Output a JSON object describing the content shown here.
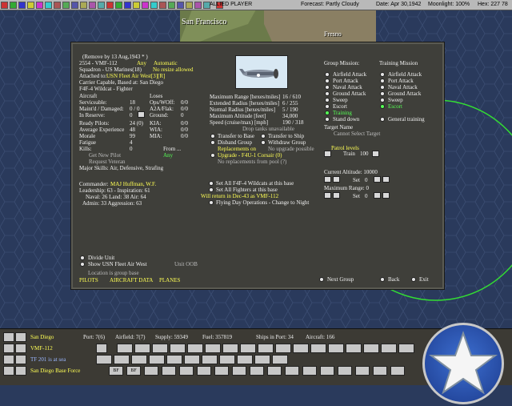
{
  "topbar": {
    "player": "ALLIED PLAYER",
    "forecast": "Forecast: Partly Cloudy",
    "date": "Date: Apr 30,1942",
    "moonlight": "Moonlight: 100%",
    "hex": "Hex: 227 78"
  },
  "map": {
    "city_label": "San Francisco",
    "city2_label": "Fresno"
  },
  "unit": {
    "removed_line": "(Remove by 13 Aug,1943 * )",
    "name": "2554 - VMF-112",
    "any": "Any",
    "automatic": "Automatic",
    "squadron": "Squadron - US Marines(18)",
    "no_resize": "No resize allowed",
    "attached_to_label": "Attached to:",
    "attached_to_value": "USN Fleet Air West[3][R]",
    "carrier_capable": "Carrier Capable, Based at: San Diego",
    "aircraft_type": "F4F-4 Wildcat - Fighter",
    "aircraft_label": "Aircraft",
    "losses_label": "Loses",
    "serviceable_label": "Serviceable:",
    "serviceable_value": "18",
    "ops_woff_label": "Ops/WOff:",
    "ops_woff_value": "0/0",
    "maint_label": "Maint'd / Damaged:",
    "maint_value": "0 / 0",
    "a2a_label": "A2A/Flak:",
    "a2a_value": "0/0",
    "reserve_label": "In Reserve:",
    "reserve_value": "0",
    "ground_label": "Ground:",
    "ground_value": "0",
    "ready_pilots_label": "Ready Pilots:",
    "ready_pilots_value": "24 (0)",
    "kia_label": "KIA:",
    "kia_value": "0/0",
    "avg_exp_label": "Average Experience",
    "avg_exp_value": "48",
    "wia_label": "WIA:",
    "wia_value": "0/0",
    "morale_label": "Morale",
    "morale_value": "99",
    "mia_label": "MIA:",
    "mia_value": "0/0",
    "fatigue_label": "Fatigue",
    "fatigue_value": "4",
    "kills_label": "Kills:",
    "kills_value": "0",
    "from_label": "From ...",
    "from_value": "Any",
    "get_new_pilot": "Get New Pilot",
    "request_veteran": "Request Veteran",
    "major_skills": "Major Skills: Air, Defensive, Strafing",
    "commander_label": "Commander:",
    "commander_value": "MAJ Huffman, W.F.",
    "leadership": "Leadership: 63 - Inspiration: 61",
    "naval_land_air": "Naval: 26  Land: 38  Air: 64",
    "admin_aggr": "Admin: 33  Aggression: 63",
    "divide_unit": "Divide Unit",
    "show_hq": "Show USN Fleet Air West",
    "unit_oob": "Unit OOB",
    "location": "Location is group base",
    "pilots": "PILOTS",
    "aircraft_data": "AIRCRAFT DATA",
    "planes": "PLANES"
  },
  "specs": {
    "max_range_label": "Maximum Range [hexes/miles]",
    "max_range_value": "16 / 610",
    "ext_radius_label": "Extended Radius [hexes/miles]",
    "ext_radius_value": "6 / 255",
    "normal_radius_label": "Normal Radius [hexes/miles]",
    "normal_radius_value": "5 / 190",
    "max_alt_label": "Maximum Altitude [feet]",
    "max_alt_value": "34,000",
    "speed_label": "Speed (cruise/max) [mph]",
    "speed_value": "190 / 318",
    "drop_tanks": "Drop tanks unavailable",
    "transfer_base": "Transfer to Base",
    "transfer_ship": "Transfer to Ship",
    "disband_group": "Disband Group",
    "withdraw_group": "Withdraw Group",
    "replacements_on": "Replacements on",
    "no_upgrade": "No upgrade possible",
    "upgrade": "Upgrade - F4U-1 Corsair (0)",
    "no_replacements": "No replacements from pool (?)",
    "set_all_wildcats": "Set All F4F-4 Wildcats at this base",
    "set_all_fighters": "Set All Fighters at this base",
    "will_return": "Will return in Dec-43 as VMF-112",
    "flying_day": "Flying Day Operations - Change to Night"
  },
  "missions": {
    "group_title": "Group Mission:",
    "training_title": "Training Mission",
    "group_items": [
      "Airfield Attack",
      "Port Attack",
      "Naval Attack",
      "Ground Attack",
      "Sweep",
      "Escort",
      "Training",
      "Stand down"
    ],
    "training_items": [
      "Airfield Attack",
      "Port Attack",
      "Naval Attack",
      "Ground Attack",
      "Sweep",
      "Escort",
      "General training"
    ],
    "target_name_label": "Target Name",
    "target_name_value": "Cannot Select Target",
    "patrol_levels": "Patrol levels",
    "train_label": "Train",
    "train_value": "100",
    "set_label": "Set",
    "set_value_1": "0",
    "current_alt_label": "Current Altitude: 10000",
    "set_value_2": "0",
    "max_range_label": "Maximum Range: 0",
    "set_value_3": "0",
    "next_group": "Next Group",
    "back": "Back",
    "exit": "Exit"
  },
  "bottom": {
    "row1_name": "San Diego",
    "row1_port": "Port: 7(6)",
    "row1_airfield": "Airfield: 7(7)",
    "row1_supply": "Supply: 59349",
    "row1_fuel": "Fuel: 357819",
    "row1_ships": "Ships in Port: 34",
    "row1_aircraft": "Aircraft: 166",
    "row2_name": "VMF-112",
    "row3_name": "TF 201 is at sea",
    "row4_name": "San Diego Base Force",
    "bf_label": "BF"
  },
  "colors": {
    "panel_bg": "#3f3f3a",
    "highlight_yellow": "#ffff55",
    "highlight_green": "#55ff55",
    "sea": "#2a3a5c"
  }
}
